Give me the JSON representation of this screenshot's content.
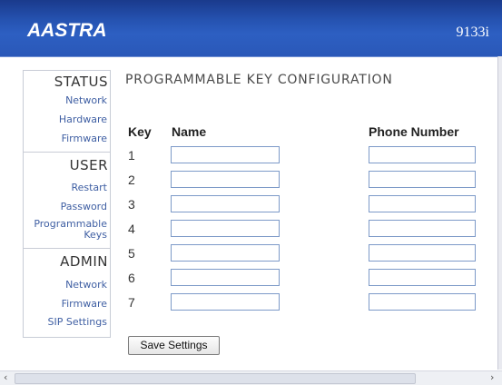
{
  "header": {
    "logo": "AASTRA",
    "model": "9133i"
  },
  "sidebar": {
    "status": {
      "heading": "STATUS",
      "links": [
        "Network",
        "Hardware",
        "Firmware"
      ]
    },
    "user": {
      "heading": "USER",
      "links": [
        "Restart",
        "Password"
      ],
      "programmable_keys": [
        "Programmable",
        "Keys"
      ]
    },
    "admin": {
      "heading": "ADMIN",
      "links": [
        "Network",
        "Firmware",
        "SIP Settings"
      ]
    }
  },
  "main": {
    "title": "PROGRAMMABLE KEY CONFIGURATION",
    "columns": {
      "key": "Key",
      "name": "Name",
      "phone": "Phone Number"
    },
    "rows": [
      {
        "key": "1",
        "name": "",
        "phone": ""
      },
      {
        "key": "2",
        "name": "",
        "phone": ""
      },
      {
        "key": "3",
        "name": "",
        "phone": ""
      },
      {
        "key": "4",
        "name": "",
        "phone": ""
      },
      {
        "key": "5",
        "name": "",
        "phone": ""
      },
      {
        "key": "6",
        "name": "",
        "phone": ""
      },
      {
        "key": "7",
        "name": "",
        "phone": ""
      }
    ],
    "save_label": "Save Settings"
  },
  "scrollbar": {
    "left_icon": "scroll-left-icon",
    "right_icon": "scroll-right-icon"
  }
}
